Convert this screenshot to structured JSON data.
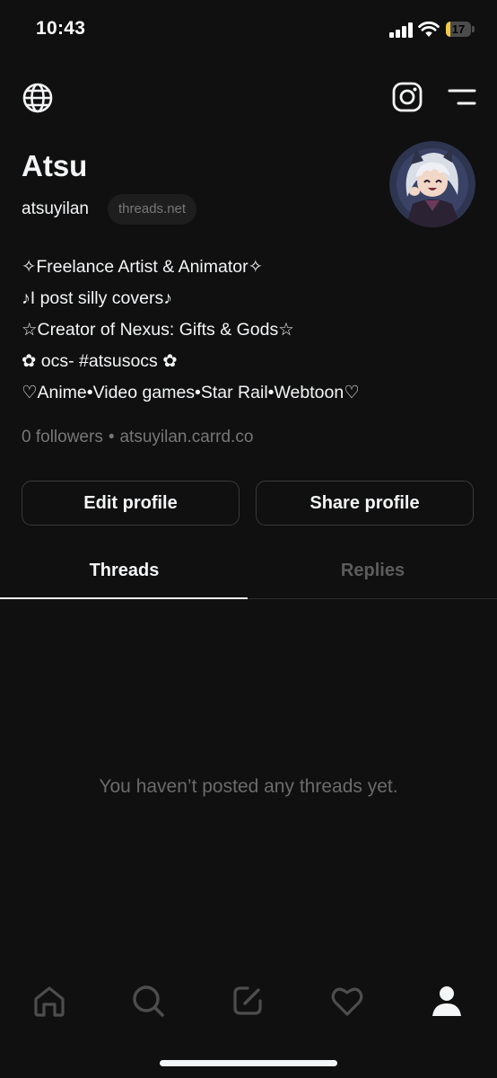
{
  "status_bar": {
    "time": "10:43",
    "battery_percent": "17",
    "battery_level": 0.17,
    "battery_color": "#f5c945"
  },
  "top_bar": {
    "left_icon": "globe-icon",
    "right_icons": [
      "instagram-icon",
      "menu-icon"
    ]
  },
  "profile": {
    "display_name": "Atsu",
    "username": "atsuyilan",
    "domain_badge": "threads.net",
    "bio": [
      "✧Freelance Artist & Animator✧",
      "♪I post silly covers♪",
      "☆Creator of Nexus: Gifts & Gods☆",
      "✿ ocs- #atsusocs ✿",
      "♡Anime•Video games•Star Rail•Webtoon♡"
    ],
    "followers": "0 followers",
    "separator": "•",
    "link": "atsuyilan.carrd.co"
  },
  "actions": {
    "edit_label": "Edit profile",
    "share_label": "Share profile"
  },
  "tabs": [
    {
      "label": "Threads",
      "active": true
    },
    {
      "label": "Replies",
      "active": false
    }
  ],
  "empty_state": "You haven’t posted any threads yet.",
  "bottom_nav": {
    "items": [
      "home-icon",
      "search-icon",
      "compose-icon",
      "heart-icon",
      "profile-icon"
    ],
    "active": "profile-icon"
  },
  "colors": {
    "background": "#101010",
    "text_primary": "#f3f5f7",
    "text_secondary": "#777777",
    "border": "#3a3a3a"
  }
}
